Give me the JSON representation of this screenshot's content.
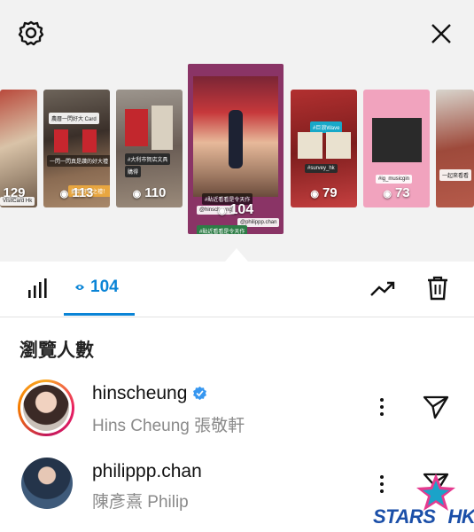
{
  "header": {
    "settings_icon": "gear-icon",
    "close_icon": "close-icon"
  },
  "stories": [
    {
      "views": "129",
      "overlay": "VisitCard Hk"
    },
    {
      "views": "113",
      "overlay": "農曆一閃好大 Card",
      "overlay2": "一閃一閃真是讚的好大禮",
      "overlay3": "抽到好禮之禮！"
    },
    {
      "views": "110",
      "overlay": "#大利市賀店文具",
      "overlay2": "購得"
    },
    {
      "views": "104",
      "overlay": "#貼近看看是令天作",
      "overlay2": "@hinscheung",
      "overlay3": "@philippp.chan",
      "overlay4": "#貼近看看是令天作"
    },
    {
      "views": "79",
      "overlay": "#巨浪Wave",
      "overlay2": "#survey_hk"
    },
    {
      "views": "73",
      "overlay": "#ig_musicgin"
    },
    {
      "views": "",
      "overlay": "一起來看看"
    }
  ],
  "tabs": {
    "insights_icon": "bar-chart-icon",
    "views_icon": "eye-icon",
    "views_count": "104",
    "trend_icon": "trending-up-icon",
    "delete_icon": "trash-icon"
  },
  "viewers": {
    "title": "瀏覽人數",
    "list": [
      {
        "username": "hinscheung",
        "fullname": "Hins Cheung 張敬軒",
        "verified": true
      },
      {
        "username": "philippp.chan",
        "fullname": "陳彥熹 Philip",
        "verified": false
      }
    ]
  },
  "watermark": {
    "text1": "STARS",
    "text2": "HK"
  },
  "colors": {
    "accent": "#0a84d6",
    "verified": "#3797f0",
    "ring": "#e91e63"
  }
}
